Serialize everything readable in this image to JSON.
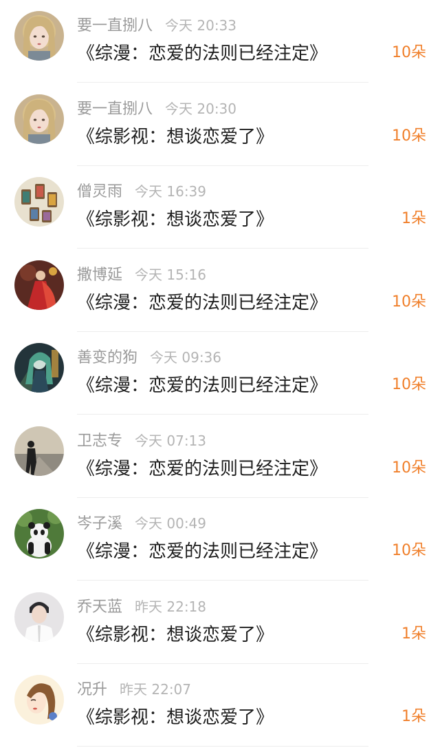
{
  "records": [
    {
      "user": "要一直捌八",
      "time": "今天 20:33",
      "book": "《综漫：恋爱的法则已经注定》",
      "gift": "10朵",
      "avatar": "anime-girl-blonde-avatar"
    },
    {
      "user": "要一直捌八",
      "time": "今天 20:30",
      "book": "《综影视：想谈恋爱了》",
      "gift": "10朵",
      "avatar": "anime-girl-blonde-avatar"
    },
    {
      "user": "僧灵雨",
      "time": "今天 16:39",
      "book": "《综影视：想谈恋爱了》",
      "gift": "1朵",
      "avatar": "thread-spools-avatar"
    },
    {
      "user": "撒博延",
      "time": "今天 15:16",
      "book": "《综漫：恋爱的法则已经注定》",
      "gift": "10朵",
      "avatar": "red-dress-figure-avatar"
    },
    {
      "user": "善变的狗",
      "time": "今天 09:36",
      "book": "《综漫：恋爱的法则已经注定》",
      "gift": "10朵",
      "avatar": "anime-character-green-avatar"
    },
    {
      "user": "卫志专",
      "time": "今天 07:13",
      "book": "《综漫：恋爱的法则已经注定》",
      "gift": "10朵",
      "avatar": "silhouette-road-avatar"
    },
    {
      "user": "岑子溪",
      "time": "今天 00:49",
      "book": "《综漫：恋爱的法则已经注定》",
      "gift": "10朵",
      "avatar": "panda-avatar"
    },
    {
      "user": "乔天蓝",
      "time": "昨天 22:18",
      "book": "《综影视：想谈恋爱了》",
      "gift": "1朵",
      "avatar": "person-white-shirt-avatar"
    },
    {
      "user": "况升",
      "time": "昨天 22:07",
      "book": "《综影视：想谈恋爱了》",
      "gift": "1朵",
      "avatar": "illustrated-girl-avatar"
    }
  ]
}
